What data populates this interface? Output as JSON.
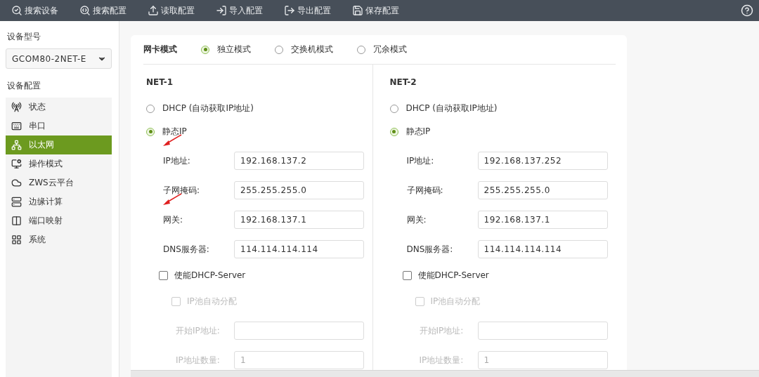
{
  "toolbar": [
    {
      "label": "搜索设备"
    },
    {
      "label": "搜索配置"
    },
    {
      "label": "读取配置"
    },
    {
      "label": "导入配置"
    },
    {
      "label": "导出配置"
    },
    {
      "label": "保存配置"
    }
  ],
  "sidebar": {
    "model_label": "设备型号",
    "model_value": "GCOM80-2NET-E",
    "config_label": "设备配置",
    "items": [
      {
        "label": "状态",
        "selected": false
      },
      {
        "label": "串口",
        "selected": false
      },
      {
        "label": "以太网",
        "selected": true
      },
      {
        "label": "操作模式",
        "selected": false
      },
      {
        "label": "ZWS云平台",
        "selected": false
      },
      {
        "label": "边缘计算",
        "selected": false
      },
      {
        "label": "端口映射",
        "selected": false
      },
      {
        "label": "系统",
        "selected": false
      }
    ]
  },
  "card": {
    "mode_label": "网卡模式",
    "modes": [
      {
        "label": "独立模式",
        "selected": true
      },
      {
        "label": "交换机模式",
        "selected": false
      },
      {
        "label": "冗余模式",
        "selected": false
      }
    ],
    "nets": [
      {
        "title": "NET-1",
        "options": [
          {
            "label": "DHCP (自动获取IP地址)",
            "selected": false
          },
          {
            "label": "静态IP",
            "selected": true
          }
        ],
        "fields": [
          {
            "label": "IP地址:",
            "value": "192.168.137.2"
          },
          {
            "label": "子网掩码:",
            "value": "255.255.255.0"
          },
          {
            "label": "网关:",
            "value": "192.168.137.1"
          },
          {
            "label": "DNS服务器:",
            "value": "114.114.114.114"
          }
        ],
        "dhcp_server": {
          "label": "使能DHCP-Server",
          "checked": false,
          "disabled": false
        },
        "pool": {
          "label": "IP池自动分配",
          "checked": false,
          "disabled": true
        },
        "pool_fields": [
          {
            "label": "开始IP地址:",
            "disabled": true
          },
          {
            "label": "IP地址数量:",
            "value": "1",
            "disabled": true
          }
        ]
      },
      {
        "title": "NET-2",
        "options": [
          {
            "label": "DHCP (自动获取IP地址)",
            "selected": false
          },
          {
            "label": "静态IP",
            "selected": true
          }
        ],
        "fields": [
          {
            "label": "IP地址:",
            "value": "192.168.137.252"
          },
          {
            "label": "子网掩码:",
            "value": "255.255.255.0"
          },
          {
            "label": "网关:",
            "value": "192.168.137.1"
          },
          {
            "label": "DNS服务器:",
            "value": "114.114.114.114"
          }
        ],
        "dhcp_server": {
          "label": "使能DHCP-Server",
          "checked": false,
          "disabled": false
        },
        "pool": {
          "label": "IP池自动分配",
          "checked": false,
          "disabled": true
        },
        "pool_fields": [
          {
            "label": "开始IP地址:",
            "disabled": true
          },
          {
            "label": "IP地址数量:",
            "value": "1",
            "disabled": true
          }
        ]
      }
    ]
  }
}
